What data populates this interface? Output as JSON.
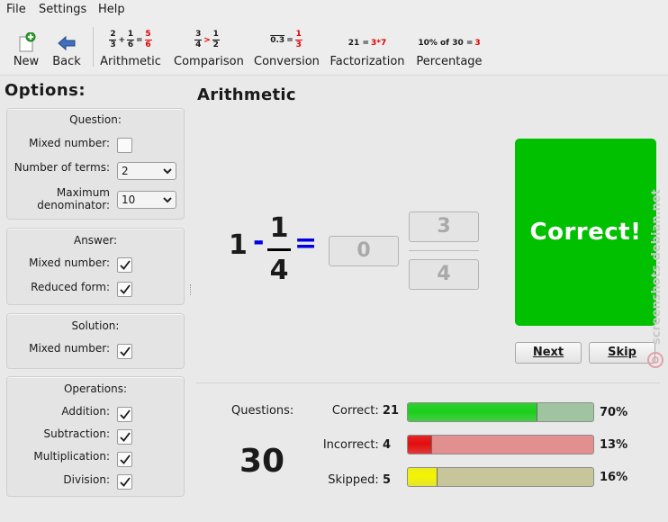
{
  "menu": {
    "file": "File",
    "settings": "Settings",
    "help": "Help"
  },
  "toolbar": {
    "new_label": "New",
    "back_label": "Back",
    "arithmetic": {
      "label": "Arithmetic",
      "icon": {
        "a_num": "2",
        "a_den": "3",
        "op": "+",
        "b_num": "1",
        "b_den": "6",
        "eq": "=",
        "r_num": "5",
        "r_den": "6"
      }
    },
    "comparison": {
      "label": "Comparison",
      "icon": {
        "a_num": "3",
        "a_den": "4",
        "op": ">",
        "b_num": "1",
        "b_den": "2"
      }
    },
    "conversion": {
      "label": "Conversion",
      "icon": {
        "left": "0.3",
        "eq": "=",
        "r_num": "1",
        "r_den": "3"
      }
    },
    "factorization": {
      "label": "Factorization",
      "icon": {
        "left": "21 =",
        "right": "3*7"
      }
    },
    "percentage": {
      "label": "Percentage",
      "icon": {
        "left": "10% of 30 =",
        "right": "3"
      }
    }
  },
  "options": {
    "title": "Options:",
    "question": {
      "title": "Question:",
      "mixed_number": {
        "label": "Mixed number:",
        "checked": false
      },
      "terms": {
        "label": "Number of terms:",
        "value": "2"
      },
      "max_den": {
        "label1": "Maximum",
        "label2": "denominator:",
        "value": "10"
      }
    },
    "answer": {
      "title": "Answer:",
      "mixed_number": {
        "label": "Mixed number:",
        "checked": true
      },
      "reduced": {
        "label": "Reduced form:",
        "checked": true
      }
    },
    "solution": {
      "title": "Solution:",
      "mixed_number": {
        "label": "Mixed number:",
        "checked": true
      }
    },
    "operations": {
      "title": "Operations:",
      "addition": {
        "label": "Addition:",
        "checked": true
      },
      "subtraction": {
        "label": "Subtraction:",
        "checked": true
      },
      "multiplication": {
        "label": "Multiplication:",
        "checked": true
      },
      "division": {
        "label": "Division:",
        "checked": true
      }
    }
  },
  "main": {
    "title": "Arithmetic",
    "task": {
      "whole": "1",
      "op": "-",
      "num": "1",
      "den": "4",
      "eq": "="
    },
    "answer": {
      "whole": "0",
      "num": "3",
      "den": "4"
    },
    "result": "Correct!",
    "next_label": "Next",
    "skip_label": "Skip"
  },
  "stats": {
    "questions_label": "Questions:",
    "questions_count": "30",
    "correct": {
      "label": "Correct:",
      "count": "21",
      "percent_text": "70%",
      "fraction": 0.7
    },
    "incorrect": {
      "label": "Incorrect:",
      "count": "4",
      "percent_text": "13%",
      "fraction": 0.13
    },
    "skipped": {
      "label": "Skipped:",
      "count": "5",
      "percent_text": "16%",
      "fraction": 0.16
    }
  },
  "watermark": "screenshots.debian.net",
  "colors": {
    "correct_fill": "#19d019",
    "correct_track": "#9fc49f",
    "incorrect_fill": "#e20d0d",
    "incorrect_track": "#e28f8f",
    "skipped_fill": "#f4f400",
    "skipped_track": "#c6c69a",
    "result_bg": "#00c000",
    "operator_blue": "#0000e0"
  }
}
